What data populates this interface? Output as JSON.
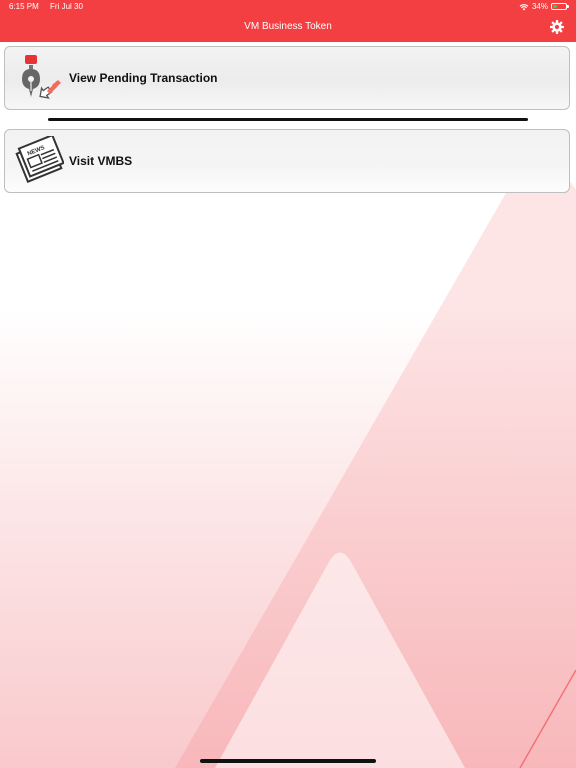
{
  "status_bar": {
    "time": "6:15 PM",
    "date": "Fri Jul 30",
    "battery_percent_text": "34%",
    "battery_level": 0.34,
    "wifi_icon": "wifi-icon",
    "battery_icon": "battery-charging-icon"
  },
  "header": {
    "title": "VM Business Token",
    "settings_icon": "gear-icon",
    "background_color": "#f33f42"
  },
  "menu": {
    "items": [
      {
        "label": "View Pending Transaction",
        "icon": "pen-pending-transaction-icon"
      },
      {
        "label": "Visit VMBS",
        "icon": "newspaper-icon",
        "icon_text": "NEWS"
      }
    ]
  },
  "colors": {
    "accent": "#f33f42",
    "background_tint": "#f9c9cc"
  }
}
